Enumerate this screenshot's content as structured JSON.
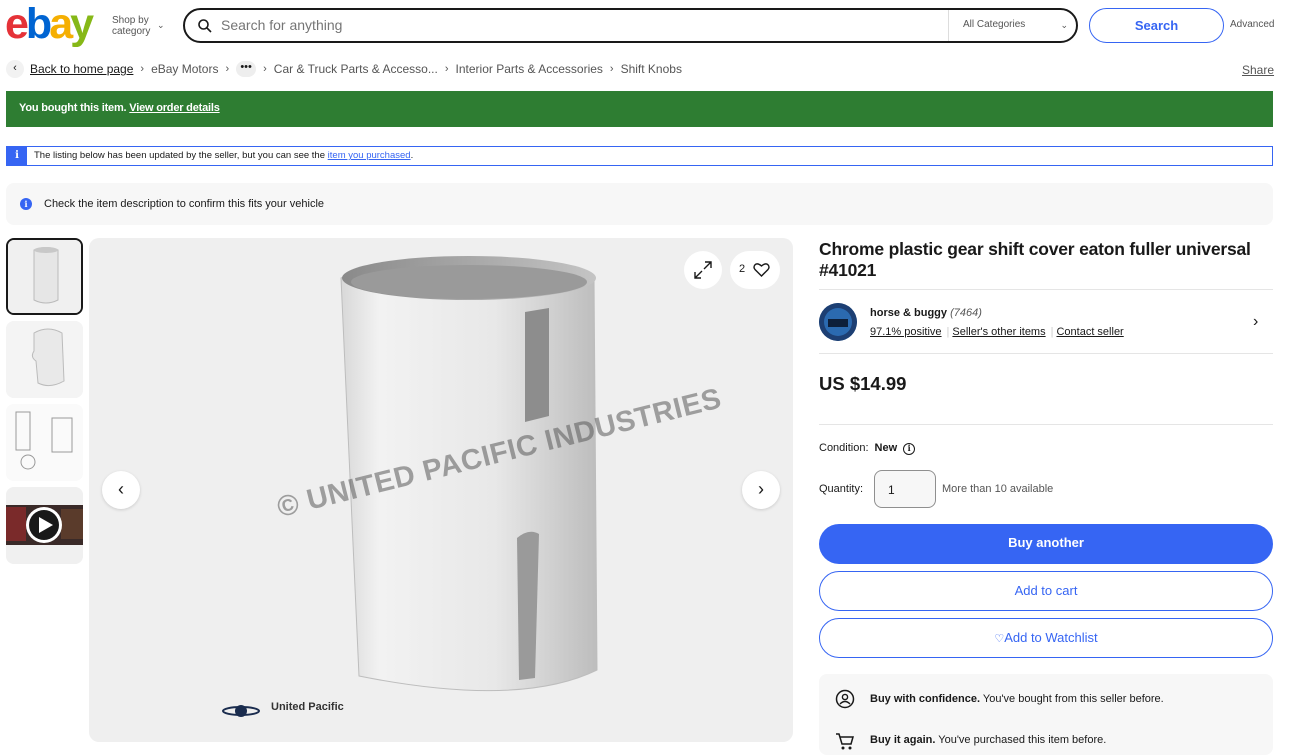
{
  "header": {
    "logo_letters": [
      "e",
      "b",
      "a",
      "y"
    ],
    "logo_colors": [
      "#e53238",
      "#0064d2",
      "#f5af02",
      "#86b817"
    ],
    "shop_by_category": [
      "Shop by",
      "category"
    ],
    "search_placeholder": "Search for anything",
    "category_select": "All Categories",
    "search_button": "Search",
    "advanced": "Advanced"
  },
  "breadcrumb": {
    "back": "Back to home page",
    "items": [
      "eBay Motors",
      "Car & Truck Parts & Accesso...",
      "Interior Parts & Accessories",
      "Shift Knobs"
    ],
    "more": "•••",
    "share": "Share"
  },
  "banners": {
    "bought_text": "You bought this item.",
    "bought_link": "View order details",
    "updated_text": "The listing below has been updated by the seller, but you can see the",
    "updated_link": "item you purchased",
    "updated_end": ".",
    "fit_text": "Check the item description to confirm this fits your vehicle"
  },
  "gallery": {
    "watch_count": "2",
    "watermark": "© UNITED PACIFIC INDUSTRIES",
    "brand": "United Pacific",
    "thumbnails": [
      "shift cover front",
      "shift cover angle",
      "shift cover diagram",
      "video"
    ]
  },
  "item": {
    "title": "Chrome plastic gear shift cover eaton fuller universal #41021",
    "seller_name": "horse & buggy",
    "seller_count": "(7464)",
    "seller_positive": "97.1% positive",
    "seller_other": "Seller's other items",
    "seller_contact": "Contact seller",
    "price": "US $14.99",
    "condition_label": "Condition:",
    "condition_value": "New",
    "quantity_label": "Quantity:",
    "quantity_value": "1",
    "availability": "More than 10 available",
    "buy_another": "Buy another",
    "add_to_cart": "Add to cart",
    "add_to_watchlist": "Add to Watchlist",
    "confidence_bold": "Buy with confidence.",
    "confidence_text": "You've bought from this seller before.",
    "again_bold": "Buy it again.",
    "again_text": "You've purchased this item before."
  },
  "colors": {
    "accent": "#3665f3",
    "success": "#2e7d32"
  }
}
